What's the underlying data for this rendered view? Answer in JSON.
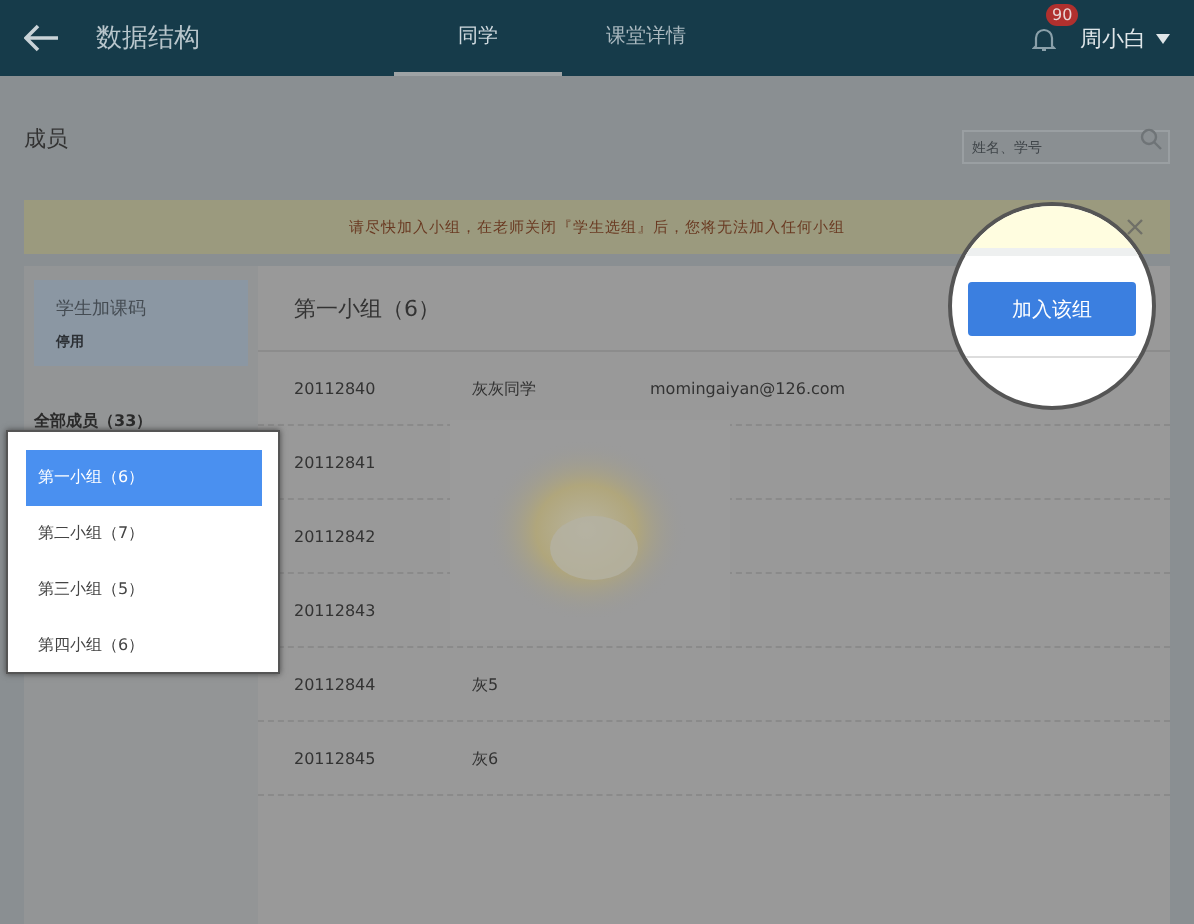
{
  "header": {
    "title": "数据结构",
    "tabs": [
      {
        "label": "同学",
        "selected": true
      },
      {
        "label": "课堂详情",
        "selected": false
      }
    ],
    "notification_count": "90",
    "user": "周小白"
  },
  "page_title": "成员",
  "search": {
    "placeholder": "姓名、学号"
  },
  "banner": {
    "text": "请尽快加入小组，在老师关闭『学生选组』后，您将无法加入任何小组"
  },
  "join_code": {
    "label": "学生加课码",
    "status": "停用"
  },
  "all_members": "全部成员（33）",
  "groups": [
    {
      "label": "第一小组（6）",
      "selected": true
    },
    {
      "label": "第二小组（7）",
      "selected": false
    },
    {
      "label": "第三小组（5）",
      "selected": false
    },
    {
      "label": "第四小组（6）",
      "selected": false
    }
  ],
  "group_title": "第一小组（6）",
  "join_button": "加入该组",
  "members": [
    {
      "id": "20112840",
      "name": "灰灰同学",
      "email": "momingaiyan@126.com"
    },
    {
      "id": "20112841"
    },
    {
      "id": "20112842"
    },
    {
      "id": "20112843"
    },
    {
      "id": "20112844",
      "name": "灰5"
    },
    {
      "id": "20112845",
      "name": "灰6"
    }
  ]
}
